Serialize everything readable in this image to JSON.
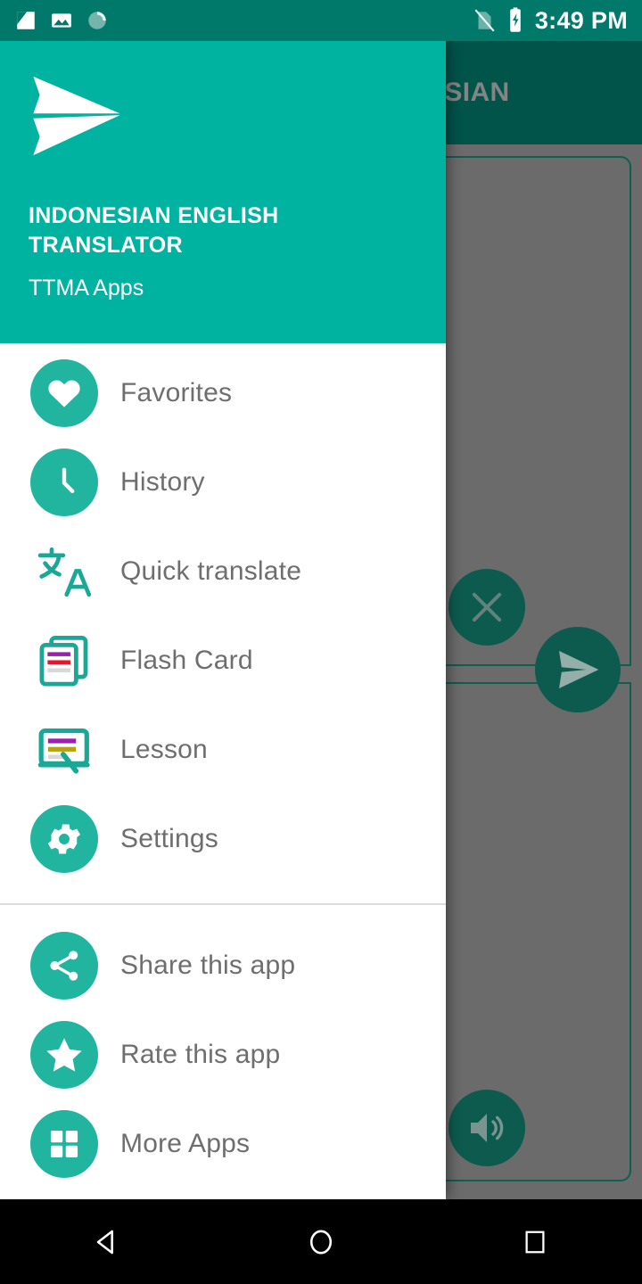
{
  "status_bar": {
    "icons": [
      "screenshot-icon",
      "image-icon",
      "sync-spinner-icon"
    ],
    "signal_icon": "no-sim-icon",
    "battery_icon": "battery-charging-icon",
    "clock": "3:49 PM",
    "background_color": "#00796b"
  },
  "drawer": {
    "logo_icon": "paper-plane-logo",
    "title": "INDONESIAN ENGLISH TRANSLATOR",
    "subtitle": "TTMA Apps",
    "header_color": "#00b3a1",
    "icon_circle_color": "#21b5a0",
    "label_color": "#6e6e6e",
    "primary_items": [
      {
        "label": "Favorites",
        "icon": "heart-icon"
      },
      {
        "label": "History",
        "icon": "clock-icon"
      },
      {
        "label": "Quick translate",
        "icon": "translate-icon"
      },
      {
        "label": "Flash Card",
        "icon": "flash-card-icon"
      },
      {
        "label": "Lesson",
        "icon": "lesson-board-icon"
      },
      {
        "label": "Settings",
        "icon": "gear-icon"
      }
    ],
    "secondary_items": [
      {
        "label": "Share this app",
        "icon": "share-icon"
      },
      {
        "label": "Rate this app",
        "icon": "star-icon"
      },
      {
        "label": "More Apps",
        "icon": "grid-apps-icon"
      }
    ]
  },
  "background_app": {
    "toolbar_title": "NDONESIAN",
    "toolbar_color": "#00544a",
    "scrim_color": "#6b6b6b",
    "card_border_color": "#0d5f52",
    "fab_color": "#0c5b4e",
    "buttons": [
      {
        "name": "clear-button",
        "icon": "close-x-icon"
      },
      {
        "name": "send-button",
        "icon": "send-paper-plane-icon"
      },
      {
        "name": "speaker-button",
        "icon": "speaker-icon"
      }
    ]
  },
  "nav_bar": {
    "back_icon": "back-triangle-icon",
    "home_icon": "home-circle-icon",
    "recents_icon": "recents-square-icon"
  }
}
